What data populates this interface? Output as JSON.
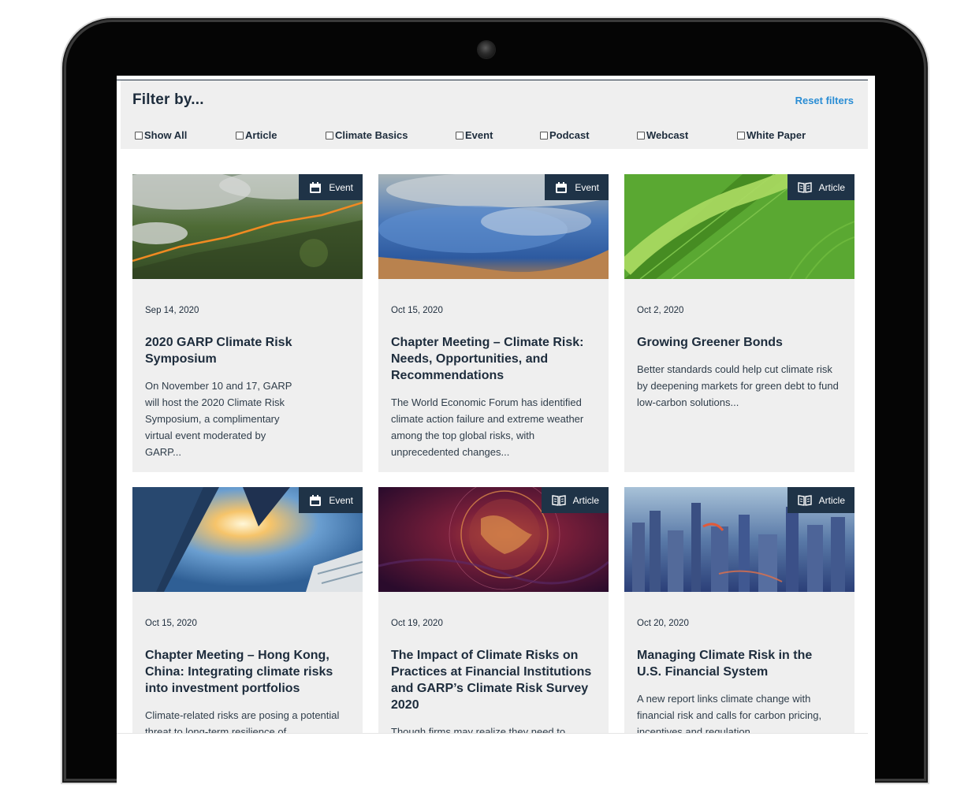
{
  "filter": {
    "title": "Filter by...",
    "reset_label": "Reset filters",
    "options": [
      "Show All",
      "Article",
      "Climate Basics",
      "Event",
      "Podcast",
      "Webcast",
      "White Paper"
    ]
  },
  "cards": [
    {
      "badge": "Event",
      "badge_icon": "calendar-icon",
      "date": "Sep 14, 2020",
      "title": "2020 GARP Climate Risk Symposium",
      "desc": "On November 10 and 17, GARP will host the 2020 Climate Risk Symposium, a complimentary virtual event moderated by GARP..."
    },
    {
      "badge": "Event",
      "badge_icon": "calendar-icon",
      "date": "Oct 15, 2020",
      "title": "Chapter Meeting – Climate Risk: Needs, Opportunities, and Recommendations",
      "desc": "The World Economic Forum has identified climate action failure and extreme weather among the top global risks, with unprecedented changes..."
    },
    {
      "badge": "Article",
      "badge_icon": "book-icon",
      "date": "Oct 2, 2020",
      "title": "Growing Greener Bonds",
      "desc": "Better standards could help cut climate risk by deepening markets for green debt to fund low-carbon solutions..."
    },
    {
      "badge": "Event",
      "badge_icon": "calendar-icon",
      "date": "Oct 15, 2020",
      "title": "Chapter Meeting – Hong Kong, China: Integrating climate risks into investment portfolios",
      "desc": "Climate-related risks are posing a potential threat to long-term resilience of"
    },
    {
      "badge": "Article",
      "badge_icon": "book-icon",
      "date": "Oct 19, 2020",
      "title": "The Impact of Climate Risks on Practices at Financial Institutions and GARP’s Climate Risk Survey 2020",
      "desc": "Though firms may realize they need to"
    },
    {
      "badge": "Article",
      "badge_icon": "book-icon",
      "date": "Oct 20, 2020",
      "title": "Managing Climate Risk in the U.S. Financial System",
      "desc": "A new report links climate change with financial risk and calls for carbon pricing, incentives and regulation..."
    }
  ],
  "colors": {
    "navy": "#1d2c3c",
    "link": "#2a8dd4",
    "card_bg": "#efefef",
    "badge_bg": "#1f3347"
  }
}
